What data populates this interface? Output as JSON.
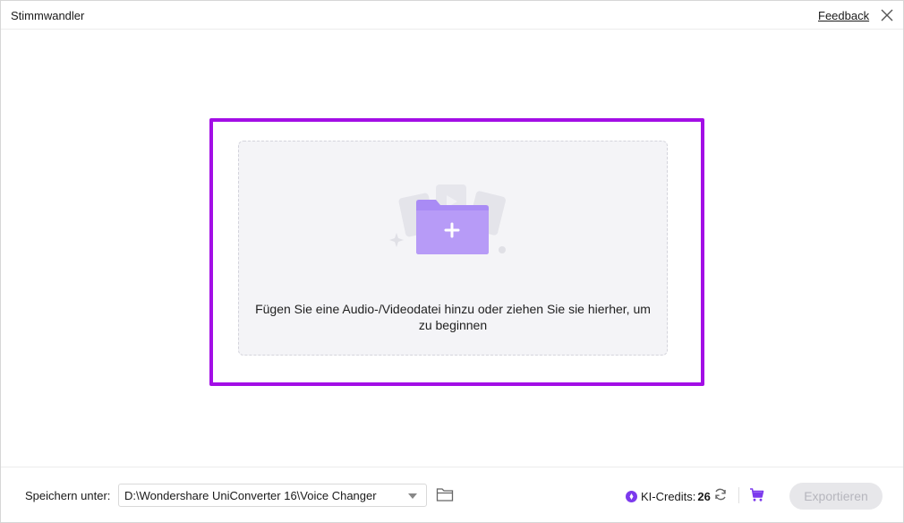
{
  "window": {
    "title": "Stimmwandler",
    "feedback_label": "Feedback"
  },
  "dropzone": {
    "text": "Fügen Sie eine Audio-/Videodatei hinzu oder ziehen Sie sie hierher, um zu beginnen",
    "icon": "folder-add-icon",
    "highlight_color": "#a30ee6"
  },
  "footer": {
    "save_label": "Speichern unter:",
    "save_path": "D:\\Wondershare UniConverter 16\\Voice Changer",
    "credits_label": "KI-Credits:",
    "credits_value": "26",
    "export_label": "Exportieren"
  },
  "colors": {
    "accent": "#8b5cf6",
    "export_disabled_bg": "#e7e7ea"
  }
}
